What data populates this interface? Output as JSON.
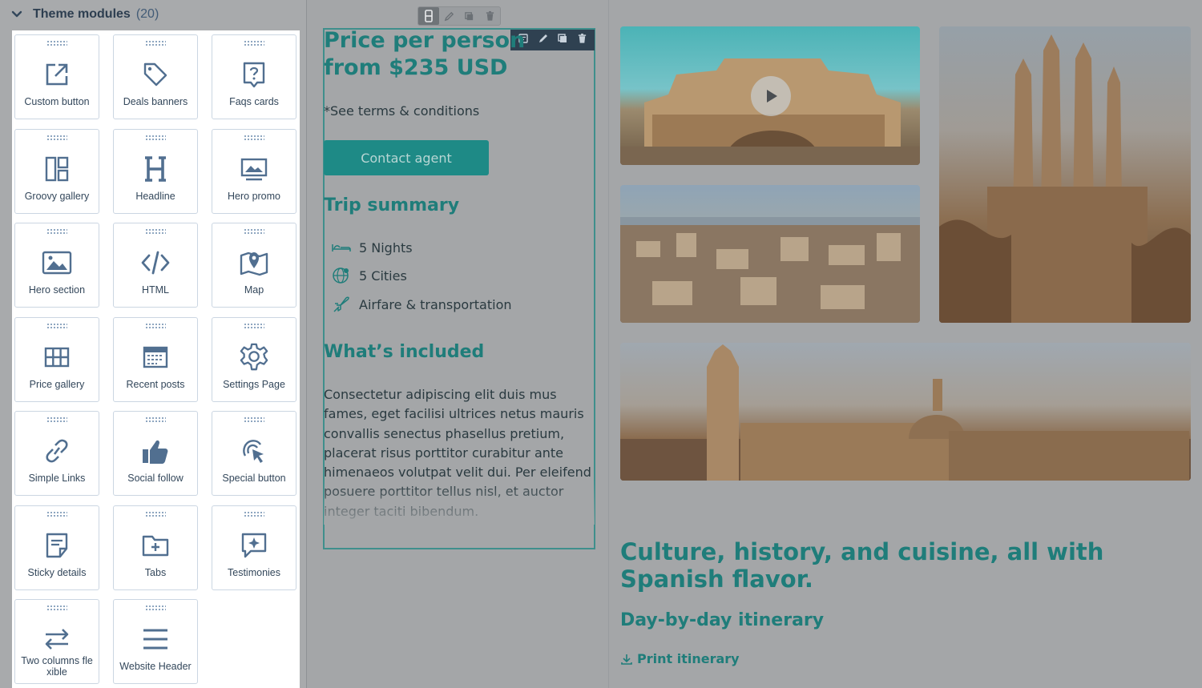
{
  "sidebar": {
    "title": "Theme modules",
    "count": "(20)",
    "modules": [
      {
        "label": "Custom button",
        "icon": "external-link-icon"
      },
      {
        "label": "Deals banners",
        "icon": "tag-icon"
      },
      {
        "label": "Faqs cards",
        "icon": "question-card-icon"
      },
      {
        "label": "Groovy gallery",
        "icon": "gallery-layout-icon"
      },
      {
        "label": "Headline",
        "icon": "heading-icon"
      },
      {
        "label": "Hero promo",
        "icon": "hero-promo-icon"
      },
      {
        "label": "Hero section",
        "icon": "image-icon"
      },
      {
        "label": "HTML",
        "icon": "code-icon"
      },
      {
        "label": "Map",
        "icon": "map-icon"
      },
      {
        "label": "Price gallery",
        "icon": "grid-icon"
      },
      {
        "label": "Recent posts",
        "icon": "calendar-icon"
      },
      {
        "label": "Settings Page",
        "icon": "gear-icon"
      },
      {
        "label": "Simple Links",
        "icon": "link-icon"
      },
      {
        "label": "Social follow",
        "icon": "thumbs-up-icon"
      },
      {
        "label": "Special button",
        "icon": "cursor-click-icon"
      },
      {
        "label": "Sticky details",
        "icon": "note-icon"
      },
      {
        "label": "Tabs",
        "icon": "folder-plus-icon"
      },
      {
        "label": "Testimonies",
        "icon": "speech-sparkle-icon"
      },
      {
        "label": "Two columns fle xible",
        "icon": "swap-arrows-icon"
      },
      {
        "label": "Website Header",
        "icon": "menu-icon"
      }
    ]
  },
  "content": {
    "price_line1": "Price per person",
    "price_line2": "from $235 USD",
    "terms": "*See terms & conditions",
    "contact_button": "Contact agent",
    "trip_summary_title": "Trip summary",
    "trip_summary_items": [
      {
        "label": "5 Nights",
        "icon": "bed-icon"
      },
      {
        "label": "5 Cities",
        "icon": "globe-icon"
      },
      {
        "label": "Airfare & transportation",
        "icon": "airplane-icon"
      }
    ],
    "whats_included_title": "What’s included",
    "body_text": "Consectetur adipiscing elit duis mus fames, eget facilisi ultrices netus mauris convallis senectus phasellus pretium, placerat risus porttitor curabitur ante himenaeos volutpat velit dui. Per eleifend posuere porttitor tellus nisl, et auctor integer taciti bibendum."
  },
  "right": {
    "culture_title": "Culture, history, and cuisine, all with Spanish flavor.",
    "itinerary_title": "Day-by-day itinerary",
    "print_link": "Print itinerary"
  },
  "colors": {
    "accent": "#1f7d7a",
    "icon": "#516f90",
    "overlay": "#a4a6a8"
  }
}
